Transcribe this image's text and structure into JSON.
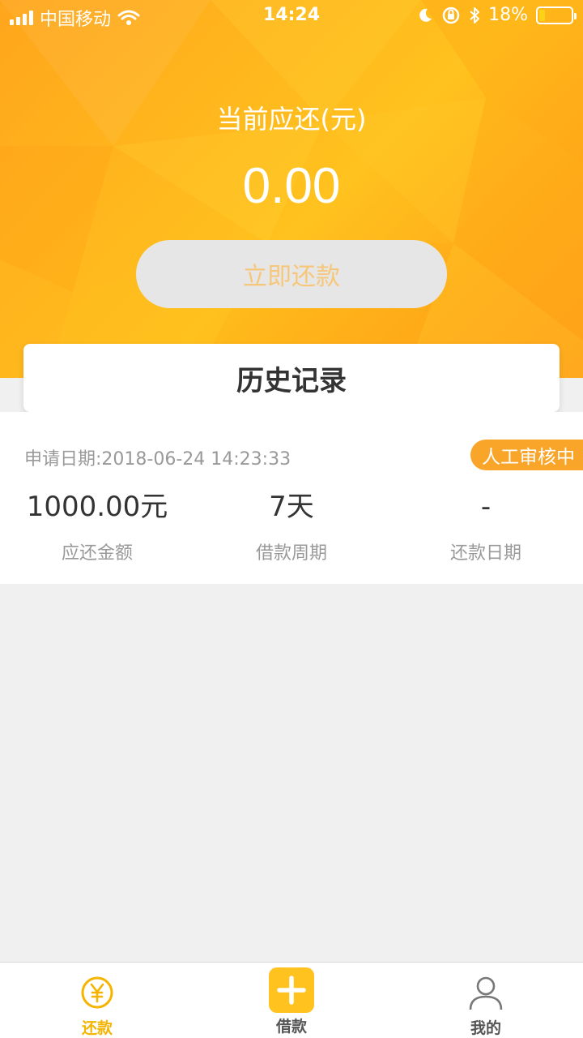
{
  "status_bar": {
    "carrier": "中国移动",
    "time": "14:24",
    "battery_percent": "18%",
    "battery_level": 0.18
  },
  "header": {
    "due_label": "当前应还(元)",
    "due_amount": "0.00",
    "repay_button": "立即还款"
  },
  "history": {
    "title": "历史记录"
  },
  "record": {
    "apply_date": "申请日期:2018-06-24 14:23:33",
    "status": "人工审核中",
    "stats": [
      {
        "value": "1000.00元",
        "label": "应还金额"
      },
      {
        "value": "7天",
        "label": "借款周期"
      },
      {
        "value": "-",
        "label": "还款日期"
      }
    ]
  },
  "tabbar": {
    "items": [
      {
        "label": "还款",
        "icon": "yen-circle-icon",
        "active": true
      },
      {
        "label": "借款",
        "icon": "plus-square-icon",
        "active": false
      },
      {
        "label": "我的",
        "icon": "user-icon",
        "active": false
      }
    ]
  },
  "colors": {
    "primary": "#FFB21D",
    "badge": "#F9A52A",
    "active_tab": "#F4B400",
    "inactive_tab": "#555555",
    "button_text": "#F6C77A"
  }
}
